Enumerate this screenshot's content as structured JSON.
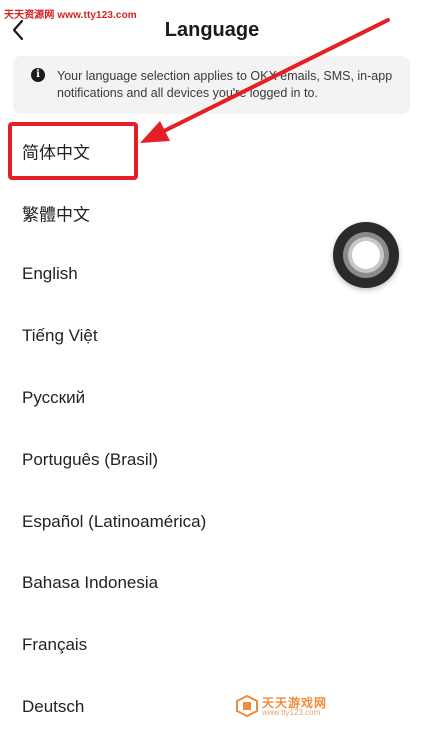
{
  "watermark": {
    "top_text": "天天资源网 www.tty123.com",
    "bottom_title": "天天游戏网",
    "bottom_url": "www.tty123.com"
  },
  "header": {
    "title": "Language",
    "back_icon": "chevron-left-icon"
  },
  "notice": {
    "icon": "info-icon",
    "icon_glyph": "i",
    "text": "Your language selection applies to OKX emails, SMS, in-app notifications and all devices you're logged in to."
  },
  "languages": [
    {
      "label": "简体中文"
    },
    {
      "label": "繁體中文"
    },
    {
      "label": "English"
    },
    {
      "label": "Tiếng Việt"
    },
    {
      "label": "Русский"
    },
    {
      "label": "Português (Brasil)"
    },
    {
      "label": "Español (Latinoamérica)"
    },
    {
      "label": "Bahasa Indonesia"
    },
    {
      "label": "Français"
    },
    {
      "label": "Deutsch"
    }
  ],
  "annotation": {
    "highlight_color": "#e51f24",
    "highlighted_item": "简体中文"
  },
  "floating_button": {
    "icon": "assistive-touch-icon"
  }
}
